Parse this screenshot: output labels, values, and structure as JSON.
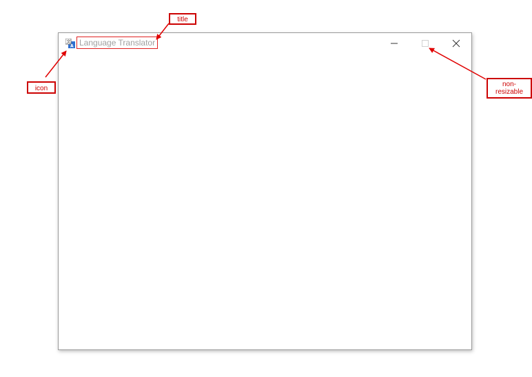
{
  "window": {
    "title": "Language Translator",
    "icon": "translate-app-icon",
    "controls": {
      "minimize": "minimize-icon",
      "maximize": "maximize-icon",
      "maximize_state": "disabled",
      "close": "close-icon"
    }
  },
  "annotations": {
    "title_label": "title",
    "icon_label": "icon",
    "nonresizable_line1": "non-",
    "nonresizable_line2": "resizable",
    "color": "#cc0000"
  }
}
